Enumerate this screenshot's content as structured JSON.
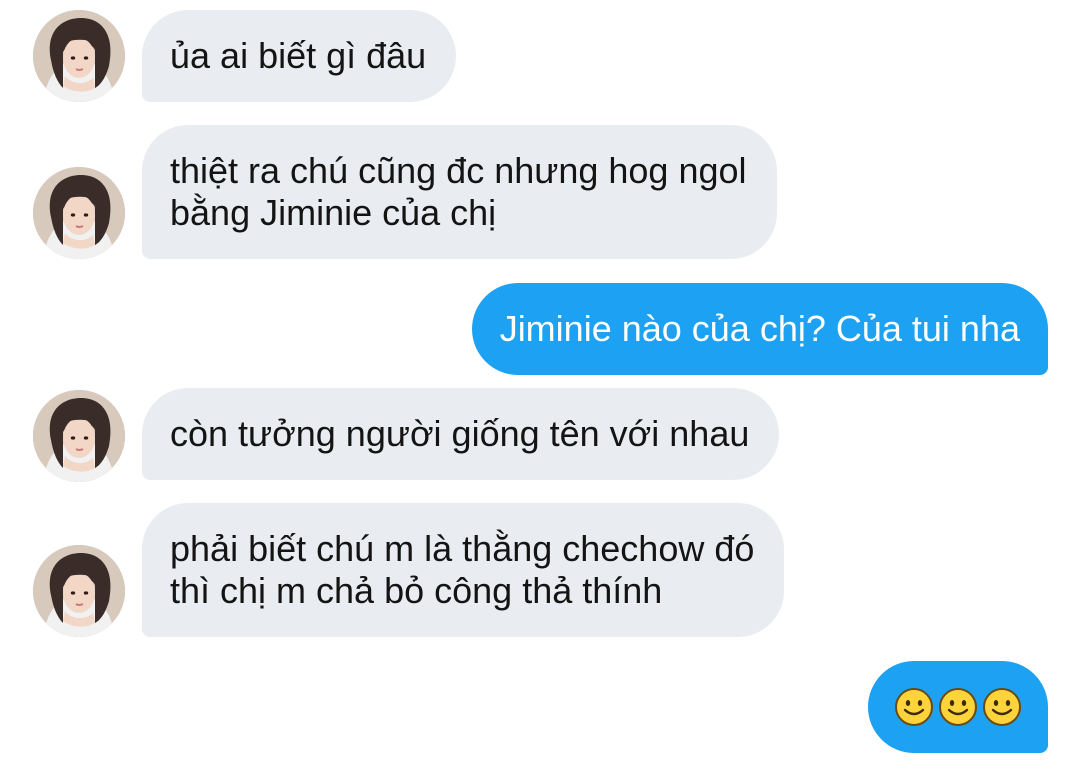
{
  "conversation": {
    "messages": [
      {
        "sender": "contact",
        "lines": [
          "ủa ai biết gì đâu"
        ]
      },
      {
        "sender": "contact",
        "lines": [
          "thiệt ra chú cũng đc nhưng hog ngol",
          "bằng Jiminie của chị"
        ]
      },
      {
        "sender": "me",
        "lines": [
          "Jiminie nào của chị? Của tui nha"
        ]
      },
      {
        "sender": "contact",
        "lines": [
          "còn tưởng người giống tên với nhau"
        ]
      },
      {
        "sender": "contact",
        "lines": [
          "phải biết chú m là thằng chechow đó",
          "thì chị m chả bỏ công thả thính"
        ]
      },
      {
        "sender": "me",
        "emoji": [
          "slightly-smiling-face-icon",
          "slightly-smiling-face-icon",
          "slightly-smiling-face-icon"
        ]
      }
    ]
  },
  "colors": {
    "incoming_bubble": "#e9edf1",
    "outgoing_bubble": "#1da1f2",
    "incoming_text": "#141414",
    "outgoing_text": "#ffffff"
  }
}
